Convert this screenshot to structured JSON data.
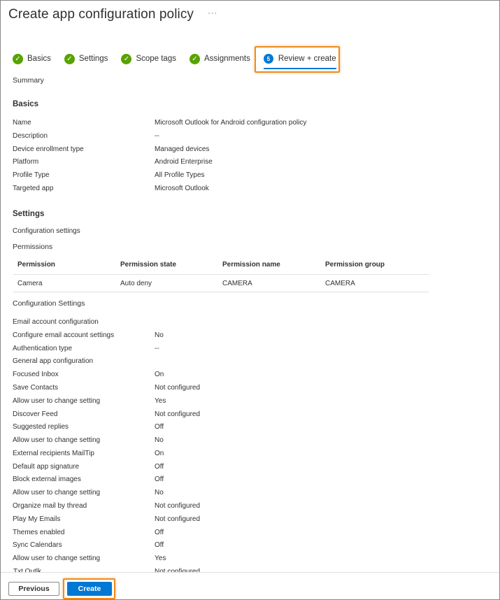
{
  "header": {
    "title": "Create app configuration policy",
    "more": "···"
  },
  "steps": [
    {
      "label": "Basics",
      "state": "done"
    },
    {
      "label": "Settings",
      "state": "done"
    },
    {
      "label": "Scope tags",
      "state": "done"
    },
    {
      "label": "Assignments",
      "state": "done"
    },
    {
      "label": "Review + create",
      "state": "current",
      "number": "5"
    }
  ],
  "summary": {
    "heading": "Summary"
  },
  "basics": {
    "heading": "Basics",
    "rows": [
      {
        "label": "Name",
        "value": "Microsoft Outlook for Android configuration policy"
      },
      {
        "label": "Description",
        "value": "--"
      },
      {
        "label": "Device enrollment type",
        "value": "Managed devices"
      },
      {
        "label": "Platform",
        "value": "Android Enterprise"
      },
      {
        "label": "Profile Type",
        "value": "All Profile Types"
      },
      {
        "label": "Targeted app",
        "value": "Microsoft Outlook"
      }
    ]
  },
  "settings": {
    "heading": "Settings",
    "config_settings_label": "Configuration settings",
    "permissions_label": "Permissions",
    "permissions_table": {
      "columns": [
        "Permission",
        "Permission state",
        "Permission name",
        "Permission group"
      ],
      "rows": [
        [
          "Camera",
          "Auto deny",
          "CAMERA",
          "CAMERA"
        ]
      ]
    },
    "configuration_settings_heading": "Configuration Settings",
    "groups": [
      {
        "title": "Email account configuration",
        "rows": [
          {
            "label": "Configure email account settings",
            "value": "No"
          },
          {
            "label": "Authentication type",
            "value": "--"
          }
        ]
      },
      {
        "title": "General app configuration",
        "rows": [
          {
            "label": "Focused Inbox",
            "value": "On"
          },
          {
            "label": "Save Contacts",
            "value": "Not configured"
          },
          {
            "label": "Allow user to change setting",
            "value": "Yes"
          },
          {
            "label": "Discover Feed",
            "value": "Not configured"
          },
          {
            "label": "Suggested replies",
            "value": "Off"
          },
          {
            "label": "Allow user to change setting",
            "value": "No"
          },
          {
            "label": "External recipients MailTip",
            "value": "On"
          },
          {
            "label": "Default app signature",
            "value": "Off"
          },
          {
            "label": "Block external images",
            "value": "Off"
          },
          {
            "label": "Allow user to change setting",
            "value": "No"
          },
          {
            "label": "Organize mail by thread",
            "value": "Not configured"
          },
          {
            "label": "Play My Emails",
            "value": "Not configured"
          },
          {
            "label": "Themes enabled",
            "value": "Off"
          },
          {
            "label": "Sync Calendars",
            "value": "Off"
          },
          {
            "label": "Allow user to change setting",
            "value": "Yes"
          }
        ]
      }
    ],
    "cut_off_row": {
      "label": "Txt Outlk...",
      "value": "Not configured"
    }
  },
  "footer": {
    "previous_label": "Previous",
    "create_label": "Create"
  },
  "colors": {
    "accent": "#0078d4",
    "success": "#57a300",
    "highlight": "#f08c1b"
  }
}
